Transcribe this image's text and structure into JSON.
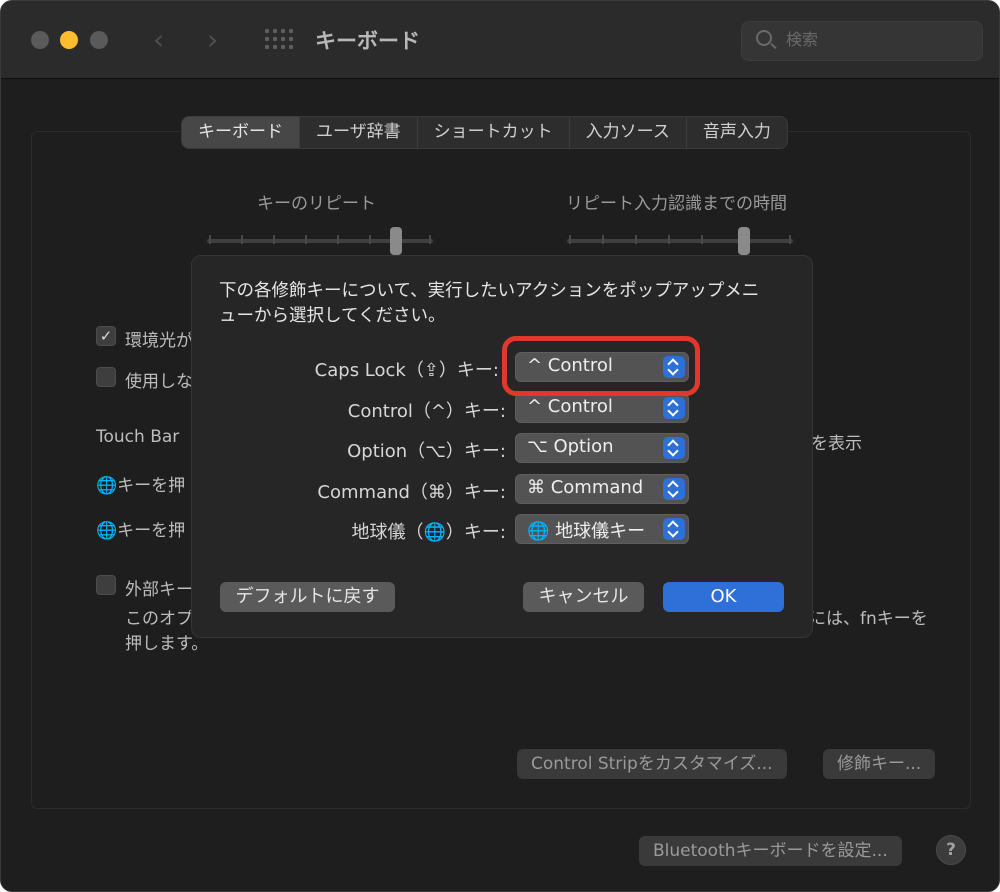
{
  "window": {
    "title": "キーボード"
  },
  "toolbar": {
    "back": "‹",
    "forward": "›"
  },
  "search": {
    "placeholder": "検索"
  },
  "tabs": [
    {
      "label": "キーボード",
      "selected": true
    },
    {
      "label": "ユーザ辞書"
    },
    {
      "label": "ショートカット"
    },
    {
      "label": "入力ソース"
    },
    {
      "label": "音声入力"
    }
  ],
  "sliders": {
    "key_repeat_label": "キーのリピート",
    "delay_label": "リピート入力認識までの時間"
  },
  "background": {
    "ambient_checkbox": "環境光が",
    "unused_checkbox": "使用しな",
    "touch_bar": "Touch Bar",
    "show_text": "を表示",
    "globe_press_1": "🌐キーを押",
    "globe_press_2": "🌐キーを押",
    "external_checkbox": "外部キー",
    "option_note_1": "このオプ",
    "option_note_2": "押します。",
    "fn_note": "には、fnキーを",
    "control_strip_button": "Control Stripをカスタマイズ...",
    "modifier_button": "修飾キー...",
    "bluetooth_button": "Bluetoothキーボードを設定...",
    "help_button": "?"
  },
  "dialog": {
    "message_line1": "下の各修飾キーについて、実行したいアクションをポップアップメニ",
    "message_line2": "ューから選択してください。",
    "rows": [
      {
        "label": "Caps Lock（⇪）キー:",
        "value": "^ Control"
      },
      {
        "label": "Control（^）キー:",
        "value": "^ Control"
      },
      {
        "label": "Option（⌥）キー:",
        "value": "⌥ Option"
      },
      {
        "label": "Command（⌘）キー:",
        "value": "⌘ Command"
      },
      {
        "label": "地球儀（🌐）キー:",
        "value": "🌐 地球儀キー"
      }
    ],
    "default_button": "デフォルトに戻す",
    "cancel_button": "キャンセル",
    "ok_button": "OK"
  },
  "colors": {
    "accent": "#2f6fd8",
    "highlight": "#e2382b",
    "minimize": "#febc2e"
  }
}
